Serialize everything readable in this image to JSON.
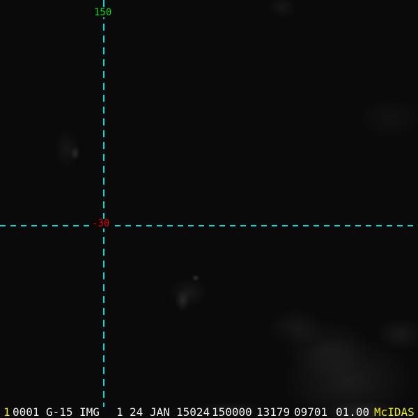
{
  "app": {
    "name": "McIDAS image display",
    "description": "GOES-15 infrared satellite image with lat/lon graticule"
  },
  "colors": {
    "background": "#080808",
    "graticule_cyan": "#00dcdc",
    "label_green": "#00dd00",
    "label_red": "#e00000",
    "text_white": "#f2f2f2",
    "text_yellow": "#ecec00"
  },
  "graticule": {
    "vertical_line_label": "150",
    "horizontal_line_label": "-30"
  },
  "status_bar": {
    "tokens": [
      {
        "name": "frame-number",
        "text": "1",
        "color": "yellow"
      },
      {
        "name": "dataset-position",
        "text": "0001",
        "color": "white"
      },
      {
        "name": "sensor",
        "text": "G-15",
        "color": "white"
      },
      {
        "name": "image-type",
        "text": "IMG",
        "color": "white"
      },
      {
        "name": "band-number",
        "text": "1",
        "color": "white"
      },
      {
        "name": "day-of-month",
        "text": "24",
        "color": "white"
      },
      {
        "name": "month",
        "text": "JAN",
        "color": "white"
      },
      {
        "name": "julian-date",
        "text": "15024",
        "color": "white"
      },
      {
        "name": "time-hhmmss",
        "text": "150000",
        "color": "white"
      },
      {
        "name": "image-line",
        "text": "13179",
        "color": "white"
      },
      {
        "name": "image-element",
        "text": "09701",
        "color": "white"
      },
      {
        "name": "magnification",
        "text": "01.00",
        "color": "white"
      },
      {
        "name": "brand",
        "text": "McIDAS",
        "color": "yellow"
      }
    ]
  }
}
